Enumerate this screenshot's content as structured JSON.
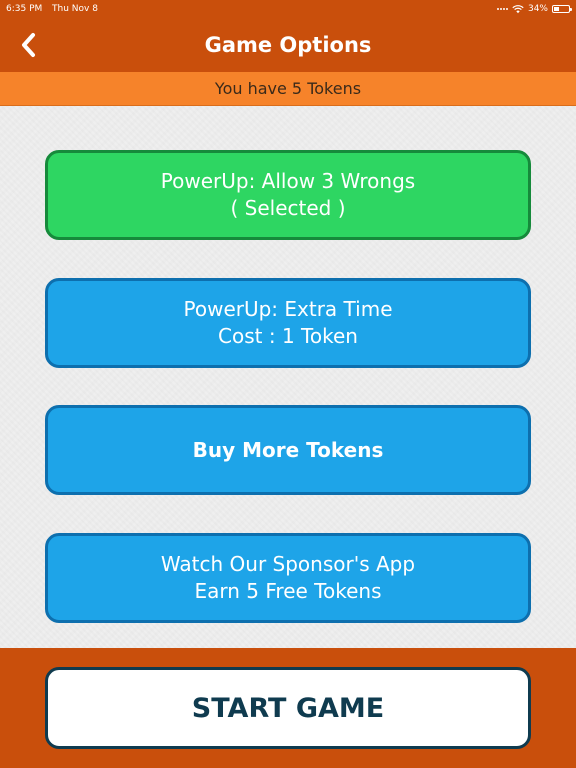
{
  "status_bar": {
    "time": "6:35 PM",
    "date": "Thu Nov 8",
    "battery": "34%",
    "battery_level": 0.34
  },
  "navbar": {
    "back_icon": "chevron-left-icon",
    "title": "Game Options"
  },
  "tokens_bar": {
    "text": "You have 5 Tokens"
  },
  "options": [
    {
      "line1": "PowerUp: Allow 3 Wrongs",
      "line2": "( Selected )",
      "state": "selected",
      "color": "#2ed662"
    },
    {
      "line1": "PowerUp: Extra Time",
      "line2": "Cost : 1 Token",
      "state": "available",
      "color": "#1ea4e8"
    },
    {
      "line1": "Buy More Tokens",
      "state": "available",
      "color": "#1ea4e8"
    },
    {
      "line1": "Watch Our Sponsor's App",
      "line2": "Earn 5 Free Tokens",
      "state": "available",
      "color": "#1ea4e8"
    }
  ],
  "footer": {
    "start_label": "START GAME"
  },
  "colors": {
    "bar_orange": "#c94f0c",
    "tokens_orange": "#f6832a",
    "start_border": "#0f3b4f"
  }
}
